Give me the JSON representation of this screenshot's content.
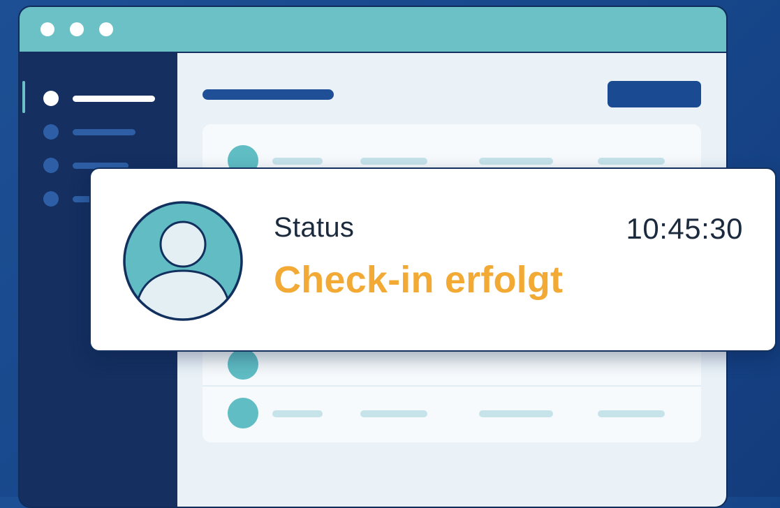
{
  "notification": {
    "label": "Status",
    "time": "10:45:30",
    "message": "Check-in erfolgt",
    "message_color": "#f2aa35",
    "avatar_icon": "user-avatar-icon"
  },
  "window": {
    "titlebar_color": "#6cc1c7",
    "controls": [
      "window-dot",
      "window-dot",
      "window-dot"
    ]
  },
  "sidebar": {
    "active_index": 0,
    "item_count": 4
  },
  "main": {
    "table_rows": 3
  },
  "colors": {
    "background": "#1d4f94",
    "sidebar": "#142f60",
    "accent": "#5fbdc3",
    "primary": "#1a4a92"
  }
}
